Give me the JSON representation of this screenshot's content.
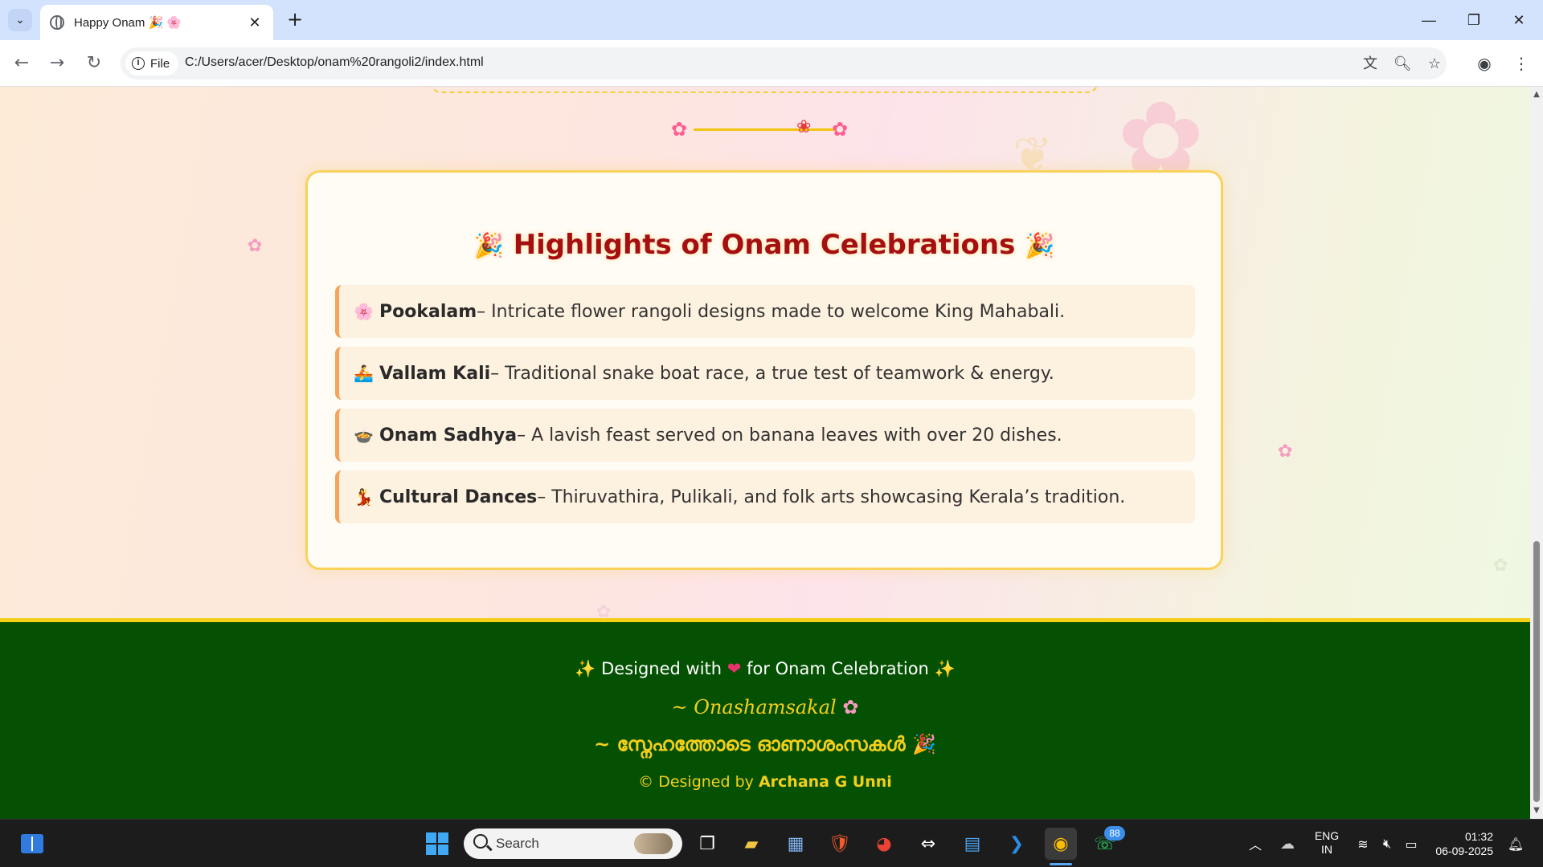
{
  "browser": {
    "tab_title": "Happy Onam 🎉 🌸",
    "address_chip": "File",
    "url": "C:/Users/acer/Desktop/onam%20rangoli2/index.html"
  },
  "page": {
    "highlights_title": "Highlights of Onam Celebrations",
    "title_emoji": "🎉",
    "highlights": [
      {
        "emoji": "🌸",
        "name": "Pookalam",
        "desc": " – Intricate flower rangoli designs made to welcome King Mahabali."
      },
      {
        "emoji": "🚣",
        "name": "Vallam Kali",
        "desc": " – Traditional snake boat race, a true test of teamwork & energy."
      },
      {
        "emoji": "🍲",
        "name": "Onam Sadhya",
        "desc": " – A lavish feast served on banana leaves with over 20 dishes."
      },
      {
        "emoji": "💃",
        "name": "Cultural Dances",
        "desc": " – Thiruvathira, Pulikali, and folk arts showcasing Kerala’s tradition."
      }
    ],
    "footer": {
      "line1_pre": "Designed with",
      "line1_post": "for Onam Celebration",
      "line2": "~ Onashamsakal",
      "line3": "~ സ്നേഹത്തോടെ ഓണാശംസകൾ",
      "credit_pre": "© Designed by ",
      "credit_name": "Archana G Unni"
    }
  },
  "taskbar": {
    "search_placeholder": "Search",
    "whatsapp_badge": "88",
    "lang_top": "ENG",
    "lang_bottom": "IN",
    "time": "01:32",
    "date": "06-09-2025"
  },
  "colors": {
    "title_red": "#a50f12",
    "footer_green": "#045103",
    "footer_gold": "#f4cf1a",
    "accent_orange": "#f7a35c"
  }
}
